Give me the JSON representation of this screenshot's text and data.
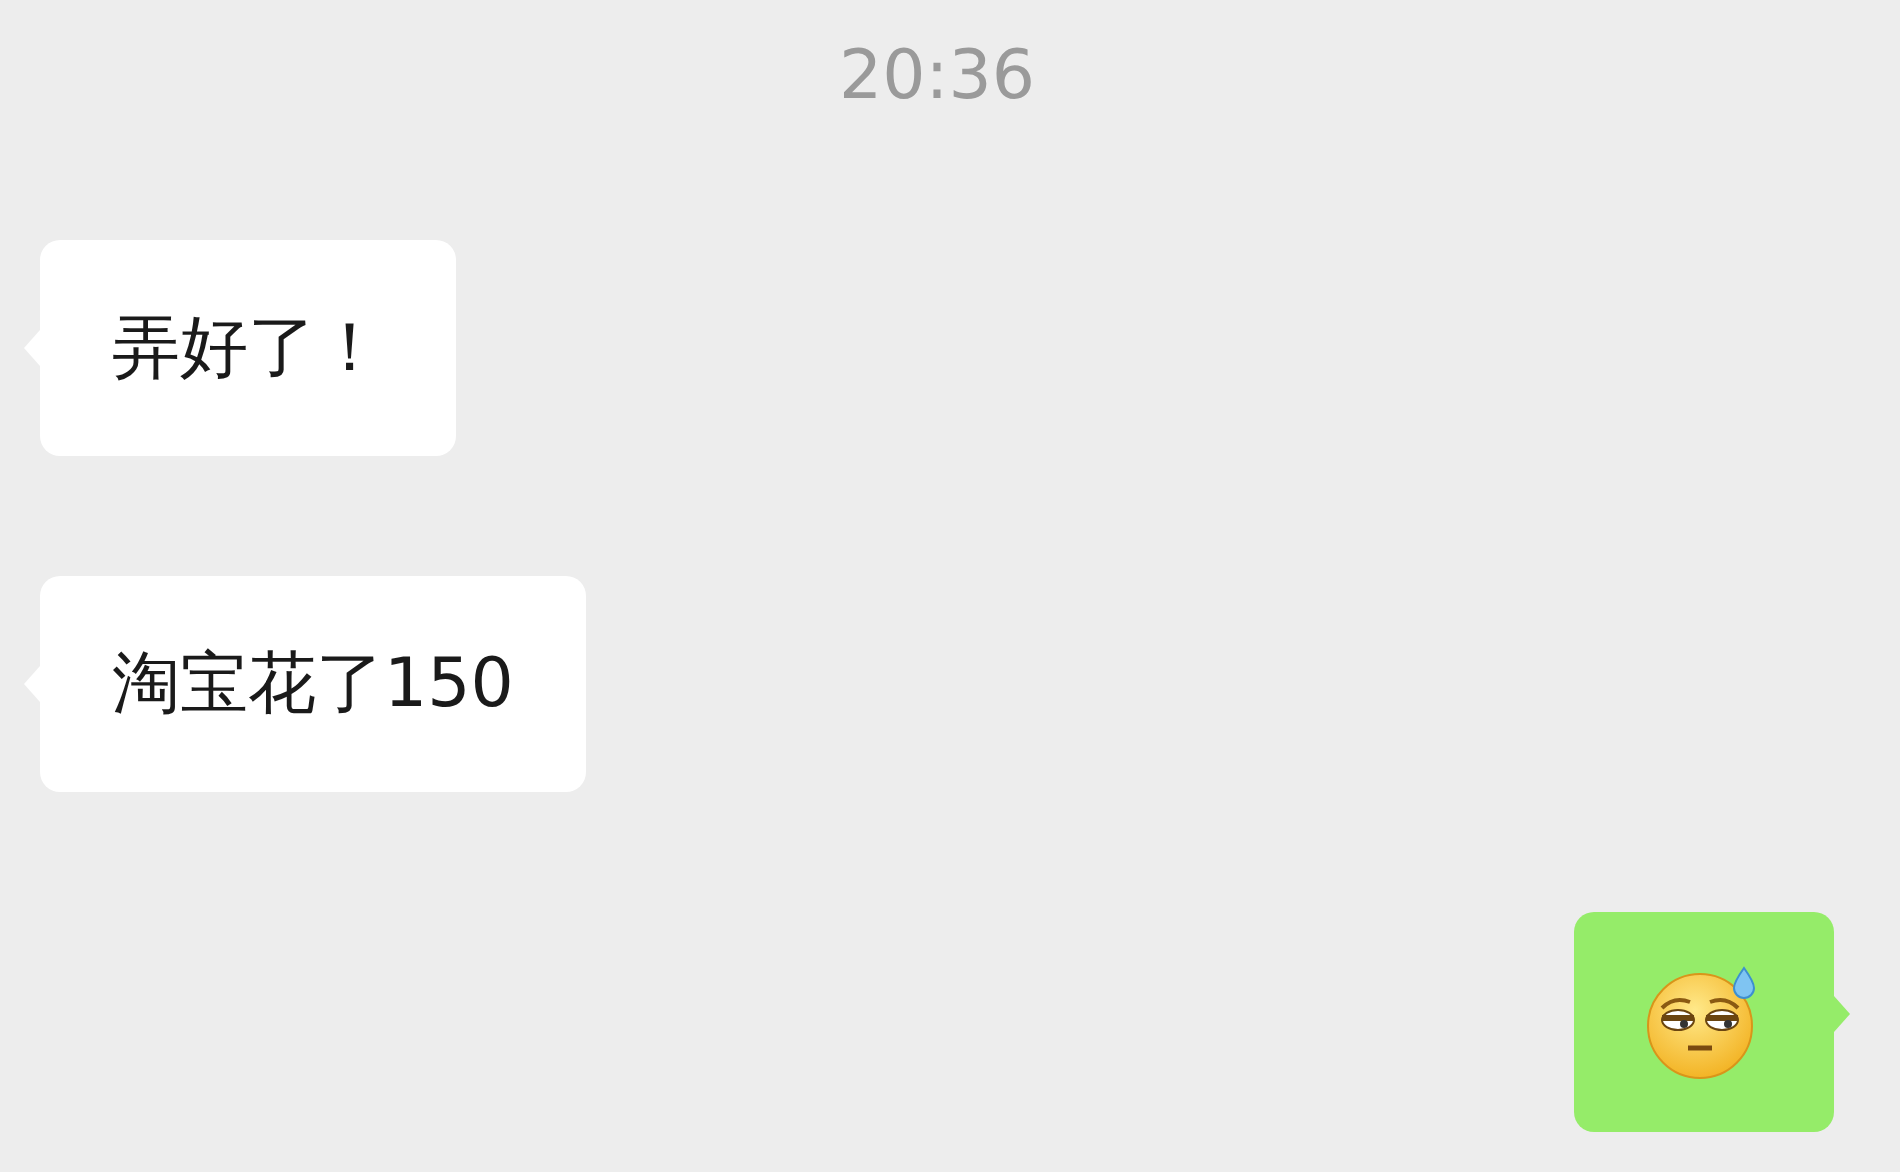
{
  "time": "20:36",
  "messages": [
    {
      "outgoing": false,
      "kind": "text",
      "text": "弄好了！"
    },
    {
      "outgoing": false,
      "kind": "text",
      "text": "淘宝花了150"
    },
    {
      "outgoing": true,
      "kind": "emoji"
    }
  ]
}
